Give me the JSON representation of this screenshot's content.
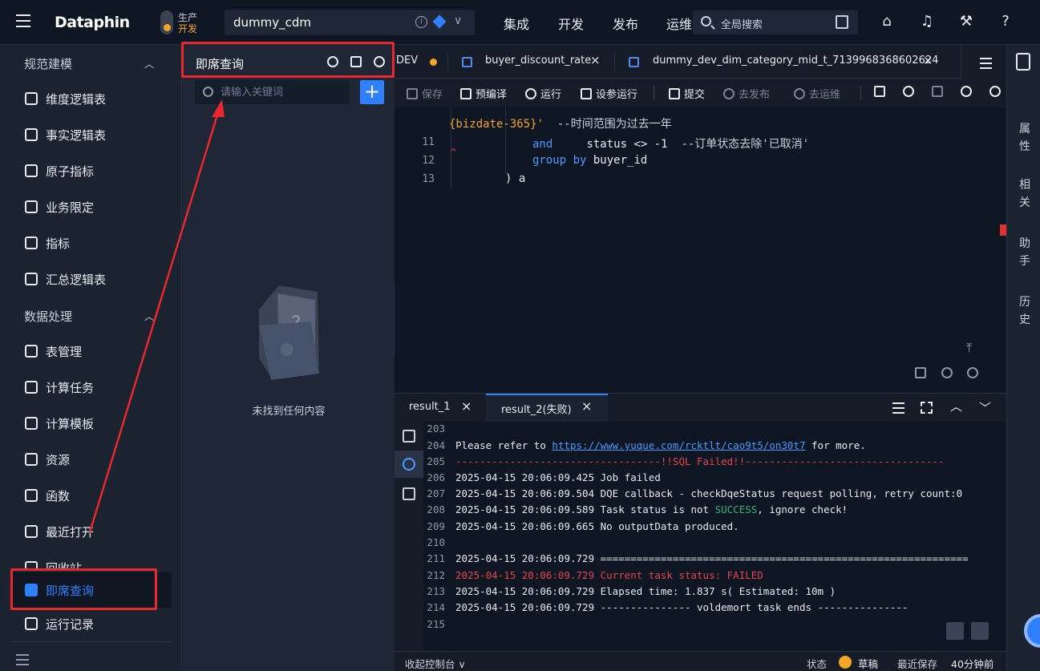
{
  "topbar": {
    "logo": "Dataphin",
    "env_line1": "生产",
    "env_line2": "开发",
    "project": "dummy_cdm",
    "nav": [
      "集成",
      "开发",
      "发布",
      "运维"
    ],
    "search_label": "全局搜索"
  },
  "sidebar": {
    "section1": "规范建模",
    "section2": "数据处理",
    "items": [
      {
        "label": "维度逻辑表",
        "icon": "dimension-table-icon"
      },
      {
        "label": "事实逻辑表",
        "icon": "fact-table-icon"
      },
      {
        "label": "原子指标",
        "icon": "atomic-metric-icon"
      },
      {
        "label": "业务限定",
        "icon": "business-filter-icon"
      },
      {
        "label": "指标",
        "icon": "metric-icon"
      },
      {
        "label": "汇总逻辑表",
        "icon": "summary-table-icon"
      },
      {
        "label": "表管理",
        "icon": "table-manage-icon"
      },
      {
        "label": "计算任务",
        "icon": "compute-task-icon"
      },
      {
        "label": "计算模板",
        "icon": "compute-template-icon"
      },
      {
        "label": "资源",
        "icon": "resource-icon"
      },
      {
        "label": "函数",
        "icon": "function-icon"
      },
      {
        "label": "最近打开",
        "icon": "recent-icon"
      },
      {
        "label": "回收站",
        "icon": "recycle-bin-icon"
      },
      {
        "label": "即席查询",
        "icon": "adhoc-query-icon"
      },
      {
        "label": "运行记录",
        "icon": "run-history-icon"
      }
    ]
  },
  "query_panel": {
    "title": "即席查询",
    "search_placeholder": "请输入关键词",
    "empty_text": "未找到任何内容"
  },
  "tabs": {
    "partial": "DEV",
    "items": [
      "buyer_discount_rate",
      "dummy_dev_dim_category_mid_t_7139968368602624"
    ]
  },
  "toolbar": {
    "save": "保存",
    "precompile": "预编译",
    "run": "运行",
    "run_with_params": "设参运行",
    "submit": "提交",
    "publish": "去发布",
    "ops": "去运维"
  },
  "editor": {
    "lines": [
      {
        "num": "",
        "text_str": "{bizdate-365}'",
        "text_cm": "  --时间范围为过去一年"
      },
      {
        "num": "11",
        "kw": "and",
        "text": "     status <> -1  ",
        "cm": "--订单状态去除'已取消'"
      },
      {
        "num": "12",
        "kw": "group by",
        "text": " buyer_id"
      },
      {
        "num": "13",
        "text": ") a"
      }
    ]
  },
  "right_side": [
    "属性",
    "相关",
    "助手",
    "历史"
  ],
  "results": {
    "tabs": [
      "result_1",
      "result_2(失败)"
    ],
    "log": [
      {
        "n": "203",
        "t": ""
      },
      {
        "n": "204",
        "t": "Please refer to ",
        "link": "https://www.yuque.com/rcktlt/cao9t5/on30t7",
        "after": " for more."
      },
      {
        "n": "205",
        "t": "----------------------------------!!SQL Failed!!---------------------------------",
        "cls": "err"
      },
      {
        "n": "206",
        "t": "2025-04-15 20:06:09.425 Job failed"
      },
      {
        "n": "207",
        "t": "2025-04-15 20:06:09.504 DQE callback - checkDqeStatus request polling, retry count:0"
      },
      {
        "n": "208",
        "t": "2025-04-15 20:06:09.589 Task status is not ",
        "ok": "SUCCESS",
        "after": ", ignore check!"
      },
      {
        "n": "209",
        "t": "2025-04-15 20:06:09.665 No outputData produced."
      },
      {
        "n": "210",
        "t": ""
      },
      {
        "n": "211",
        "t": "2025-04-15 20:06:09.729 ============================================================="
      },
      {
        "n": "212",
        "t": "2025-04-15 20:06:09.729 Current task status: FAILED",
        "cls": "red"
      },
      {
        "n": "213",
        "t": "2025-04-15 20:06:09.729 Elapsed time: 1.837 s( Estimated: 10m )"
      },
      {
        "n": "214",
        "t": "2025-04-15 20:06:09.729 --------------- voldemort task ends ---------------"
      },
      {
        "n": "215",
        "t": ""
      }
    ]
  },
  "statusbar": {
    "console": "收起控制台",
    "state_label": "状态",
    "state_value": "草稿",
    "saved_label": "最近保存",
    "saved_value": "40分钟前"
  }
}
